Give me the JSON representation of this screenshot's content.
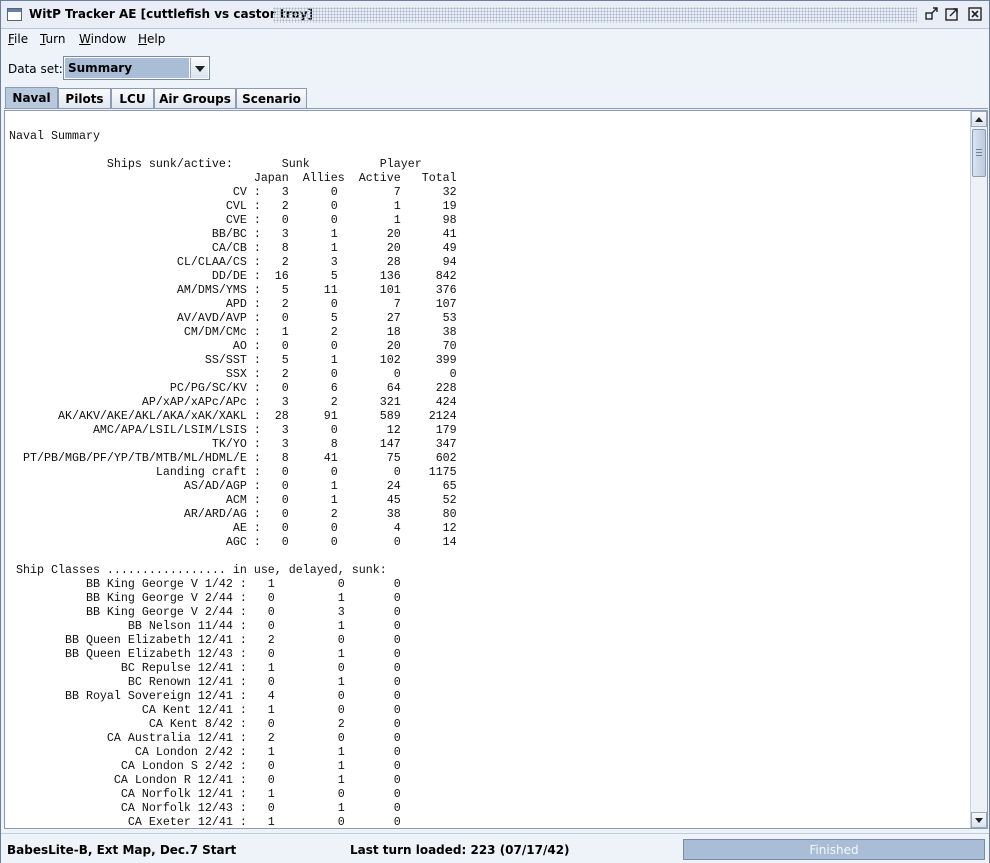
{
  "window": {
    "title": "WitP Tracker AE [cuttlefish vs castor troy]"
  },
  "menubar": {
    "items": [
      {
        "label": "File",
        "mnemonic": "F",
        "rest": "ile"
      },
      {
        "label": "Turn",
        "mnemonic": "T",
        "rest": "urn"
      },
      {
        "label": "Window",
        "mnemonic": "W",
        "rest": "indow"
      },
      {
        "label": "Help",
        "mnemonic": "H",
        "rest": "elp"
      }
    ]
  },
  "dataset": {
    "label": "Data set:",
    "selected": "Summary"
  },
  "tabs": [
    {
      "label": "Naval",
      "active": true
    },
    {
      "label": "Pilots",
      "active": false
    },
    {
      "label": "LCU",
      "active": false
    },
    {
      "label": "Air Groups",
      "active": false
    },
    {
      "label": "Scenario",
      "active": false
    }
  ],
  "report": {
    "title": "Naval Summary",
    "ships_header_1": "              Ships sunk/active:       Sunk          Player",
    "ships_header_2": "                                   Japan  Allies  Active   Total",
    "ship_rows": [
      {
        "type": "CV",
        "japan": "3",
        "allies": "0",
        "active": "7",
        "total": "32"
      },
      {
        "type": "CVL",
        "japan": "2",
        "allies": "0",
        "active": "1",
        "total": "19"
      },
      {
        "type": "CVE",
        "japan": "0",
        "allies": "0",
        "active": "1",
        "total": "98"
      },
      {
        "type": "BB/BC",
        "japan": "3",
        "allies": "1",
        "active": "20",
        "total": "41"
      },
      {
        "type": "CA/CB",
        "japan": "8",
        "allies": "1",
        "active": "20",
        "total": "49"
      },
      {
        "type": "CL/CLAA/CS",
        "japan": "2",
        "allies": "3",
        "active": "28",
        "total": "94"
      },
      {
        "type": "DD/DE",
        "japan": "16",
        "allies": "5",
        "active": "136",
        "total": "842"
      },
      {
        "type": "AM/DMS/YMS",
        "japan": "5",
        "allies": "11",
        "active": "101",
        "total": "376"
      },
      {
        "type": "APD",
        "japan": "2",
        "allies": "0",
        "active": "7",
        "total": "107"
      },
      {
        "type": "AV/AVD/AVP",
        "japan": "0",
        "allies": "5",
        "active": "27",
        "total": "53"
      },
      {
        "type": "CM/DM/CMc",
        "japan": "1",
        "allies": "2",
        "active": "18",
        "total": "38"
      },
      {
        "type": "AO",
        "japan": "0",
        "allies": "0",
        "active": "20",
        "total": "70"
      },
      {
        "type": "SS/SST",
        "japan": "5",
        "allies": "1",
        "active": "102",
        "total": "399"
      },
      {
        "type": "SSX",
        "japan": "2",
        "allies": "0",
        "active": "0",
        "total": "0"
      },
      {
        "type": "PC/PG/SC/KV",
        "japan": "0",
        "allies": "6",
        "active": "64",
        "total": "228"
      },
      {
        "type": "AP/xAP/xAPc/APc",
        "japan": "3",
        "allies": "2",
        "active": "321",
        "total": "424"
      },
      {
        "type": "AK/AKV/AKE/AKL/AKA/xAK/XAKL",
        "japan": "28",
        "allies": "91",
        "active": "589",
        "total": "2124"
      },
      {
        "type": "AMC/APA/LSIL/LSIM/LSIS",
        "japan": "3",
        "allies": "0",
        "active": "12",
        "total": "179"
      },
      {
        "type": "TK/YO",
        "japan": "3",
        "allies": "8",
        "active": "147",
        "total": "347"
      },
      {
        "type": "PT/PB/MGB/PF/YP/TB/MTB/ML/HDML/E",
        "japan": "8",
        "allies": "41",
        "active": "75",
        "total": "602"
      },
      {
        "type": "Landing craft",
        "japan": "0",
        "allies": "0",
        "active": "0",
        "total": "1175"
      },
      {
        "type": "AS/AD/AGP",
        "japan": "0",
        "allies": "1",
        "active": "24",
        "total": "65"
      },
      {
        "type": "ACM",
        "japan": "0",
        "allies": "1",
        "active": "45",
        "total": "52"
      },
      {
        "type": "AR/ARD/AG",
        "japan": "0",
        "allies": "2",
        "active": "38",
        "total": "80"
      },
      {
        "type": "AE",
        "japan": "0",
        "allies": "0",
        "active": "4",
        "total": "12"
      },
      {
        "type": "AGC",
        "japan": "0",
        "allies": "0",
        "active": "0",
        "total": "14"
      }
    ],
    "classes_header": " Ship Classes ................. in use, delayed, sunk:",
    "class_rows": [
      {
        "name": "BB King George V 1/42",
        "in_use": "1",
        "delayed": "0",
        "sunk": "0"
      },
      {
        "name": "BB King George V 2/44",
        "in_use": "0",
        "delayed": "1",
        "sunk": "0"
      },
      {
        "name": "BB King George V 2/44",
        "in_use": "0",
        "delayed": "3",
        "sunk": "0"
      },
      {
        "name": "BB Nelson 11/44",
        "in_use": "0",
        "delayed": "1",
        "sunk": "0"
      },
      {
        "name": "BB Queen Elizabeth 12/41",
        "in_use": "2",
        "delayed": "0",
        "sunk": "0"
      },
      {
        "name": "BB Queen Elizabeth 12/43",
        "in_use": "0",
        "delayed": "1",
        "sunk": "0"
      },
      {
        "name": "BC Repulse 12/41",
        "in_use": "1",
        "delayed": "0",
        "sunk": "0"
      },
      {
        "name": "BC Renown 12/41",
        "in_use": "0",
        "delayed": "1",
        "sunk": "0"
      },
      {
        "name": "BB Royal Sovereign 12/41",
        "in_use": "4",
        "delayed": "0",
        "sunk": "0"
      },
      {
        "name": "CA Kent 12/41",
        "in_use": "1",
        "delayed": "0",
        "sunk": "0"
      },
      {
        "name": "CA Kent 8/42",
        "in_use": "0",
        "delayed": "2",
        "sunk": "0"
      },
      {
        "name": "CA Australia 12/41",
        "in_use": "2",
        "delayed": "0",
        "sunk": "0"
      },
      {
        "name": "CA London 2/42",
        "in_use": "1",
        "delayed": "1",
        "sunk": "0"
      },
      {
        "name": "CA London S 2/42",
        "in_use": "0",
        "delayed": "1",
        "sunk": "0"
      },
      {
        "name": "CA London R 12/41",
        "in_use": "0",
        "delayed": "1",
        "sunk": "0"
      },
      {
        "name": "CA Norfolk 12/41",
        "in_use": "1",
        "delayed": "0",
        "sunk": "0"
      },
      {
        "name": "CA Norfolk 12/43",
        "in_use": "0",
        "delayed": "1",
        "sunk": "0"
      },
      {
        "name": "CA Exeter 12/41",
        "in_use": "1",
        "delayed": "0",
        "sunk": "0"
      }
    ]
  },
  "status": {
    "scenario": "BabesLite-B, Ext Map, Dec.7 Start",
    "last_turn": "Last turn loaded: 223 (07/17/42)",
    "progress_label": "Finished",
    "progress_fraction": 1.0
  }
}
